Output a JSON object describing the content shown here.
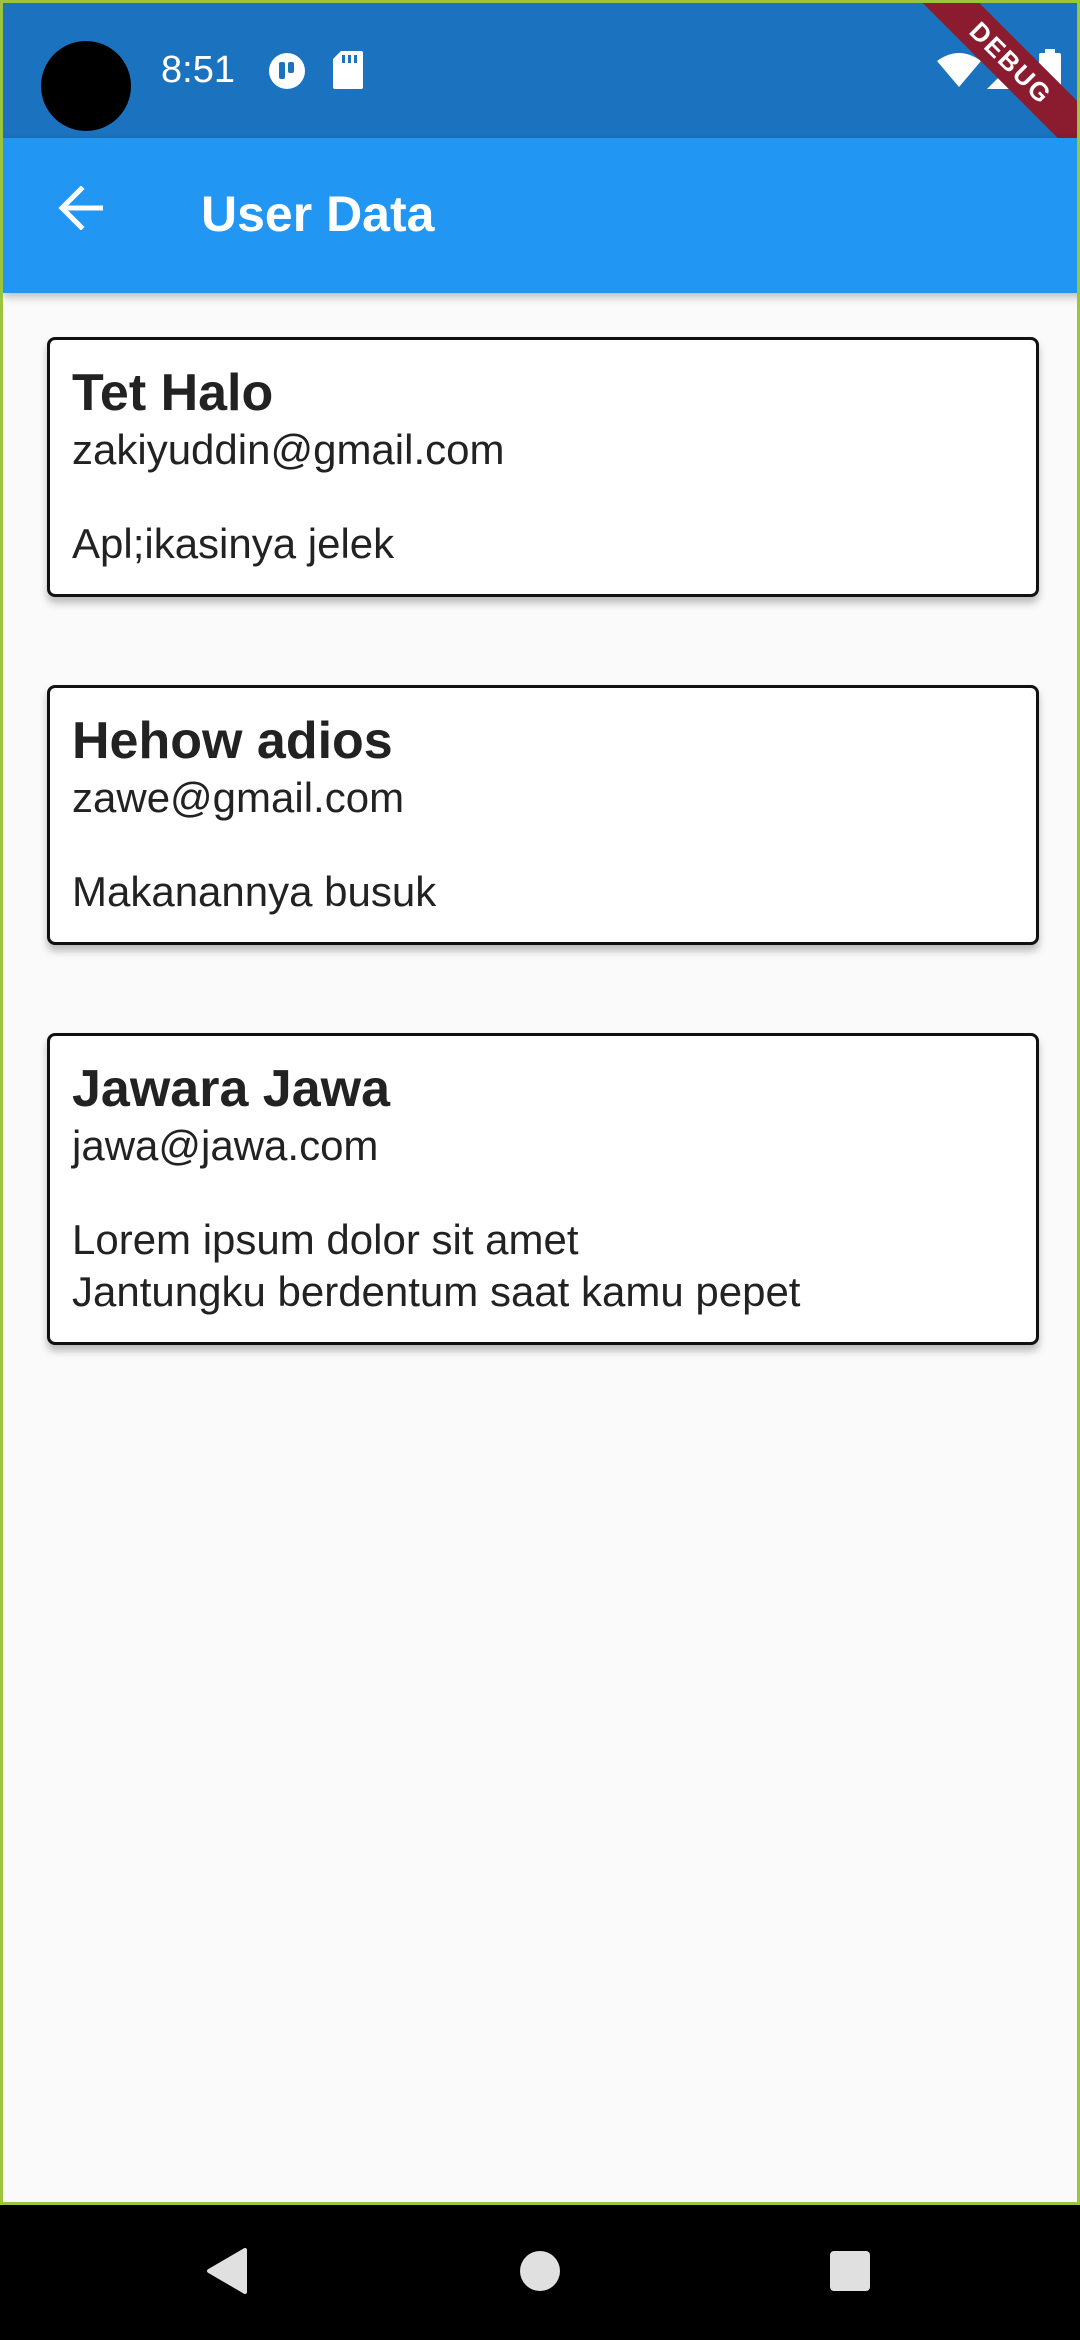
{
  "status_bar": {
    "time": "8:51",
    "icons": [
      "notification-app-icon",
      "sd-card-icon",
      "wifi-icon",
      "signal-icon",
      "battery-icon"
    ]
  },
  "app_bar": {
    "title": "User Data",
    "back_icon": "arrow-back-icon",
    "debug_label": "DEBUG"
  },
  "users": [
    {
      "name": "Tet Halo",
      "email": "zakiyuddin@gmail.com",
      "message": "Apl;ikasinya jelek"
    },
    {
      "name": "Hehow adios",
      "email": "zawe@gmail.com",
      "message": "Makanannya busuk"
    },
    {
      "name": "Jawara Jawa",
      "email": "jawa@jawa.com",
      "message": "Lorem ipsum dolor sit amet\nJantungku berdentum saat kamu pepet"
    }
  ],
  "nav_bar": {
    "icons": [
      "back-triangle-icon",
      "home-circle-icon",
      "recents-square-icon"
    ]
  },
  "colors": {
    "status_bar": "#1b72be",
    "app_bar": "#2196f3",
    "background": "#fafafa",
    "debug_banner": "#8b1b2e"
  }
}
